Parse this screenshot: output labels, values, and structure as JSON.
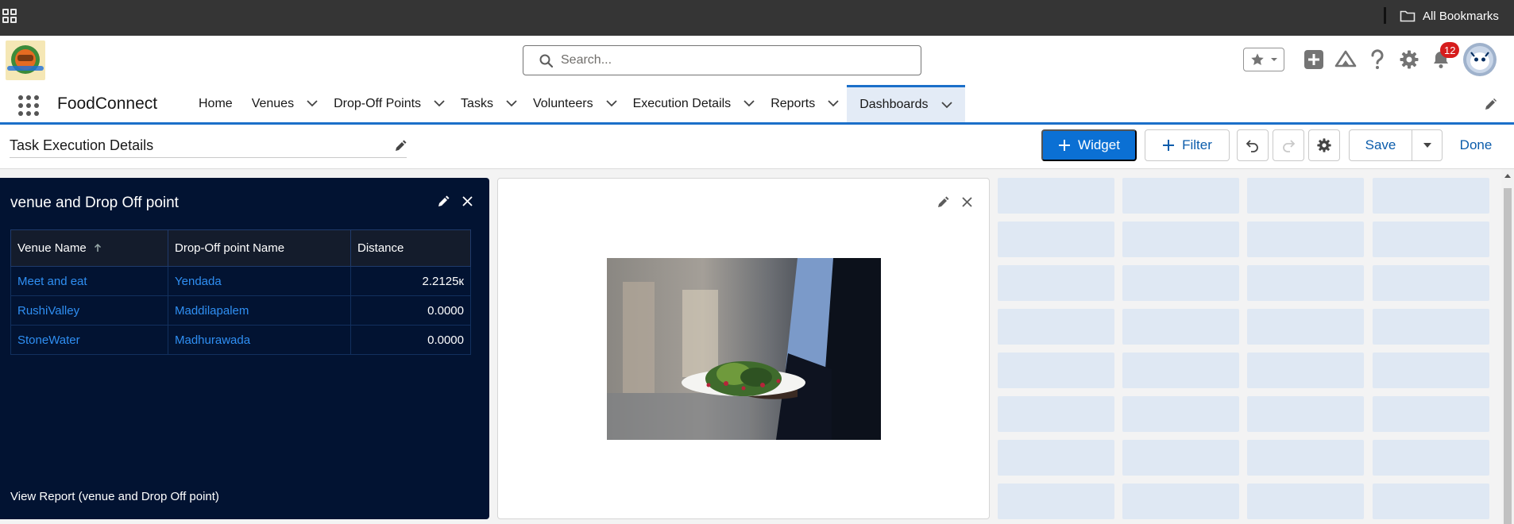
{
  "browser": {
    "bookmarks_label": "All Bookmarks"
  },
  "header": {
    "search_placeholder": "Search...",
    "notification_count": "12"
  },
  "nav": {
    "app_name": "FoodConnect",
    "tabs": [
      {
        "label": "Home",
        "has_menu": false
      },
      {
        "label": "Venues",
        "has_menu": true
      },
      {
        "label": "Drop-Off Points",
        "has_menu": true
      },
      {
        "label": "Tasks",
        "has_menu": true
      },
      {
        "label": "Volunteers",
        "has_menu": true
      },
      {
        "label": "Execution Details",
        "has_menu": true
      },
      {
        "label": "Reports",
        "has_menu": true
      },
      {
        "label": "Dashboards",
        "has_menu": true,
        "active": true
      }
    ]
  },
  "toolbar": {
    "dashboard_name": "Task Execution Details",
    "widget_label": "Widget",
    "filter_label": "Filter",
    "save_label": "Save",
    "done_label": "Done"
  },
  "table_widget": {
    "title": "venue and Drop Off point",
    "columns": [
      "Venue Name",
      "Drop-Off point Name",
      "Distance"
    ],
    "rows": [
      [
        "Meet and eat",
        "Yendada",
        "2.2125к"
      ],
      [
        "RushiValley",
        "Maddilapalem",
        "0.0000"
      ],
      [
        "StoneWater",
        "Madhurawada",
        "0.0000"
      ]
    ],
    "footer_link": "View Report (venue and Drop Off point)"
  },
  "colors": {
    "brand_blue": "#0b70d4",
    "widget_bg": "#021332",
    "link_blue": "#2f8ff3",
    "placeholder_tile": "#dfe8f3"
  }
}
